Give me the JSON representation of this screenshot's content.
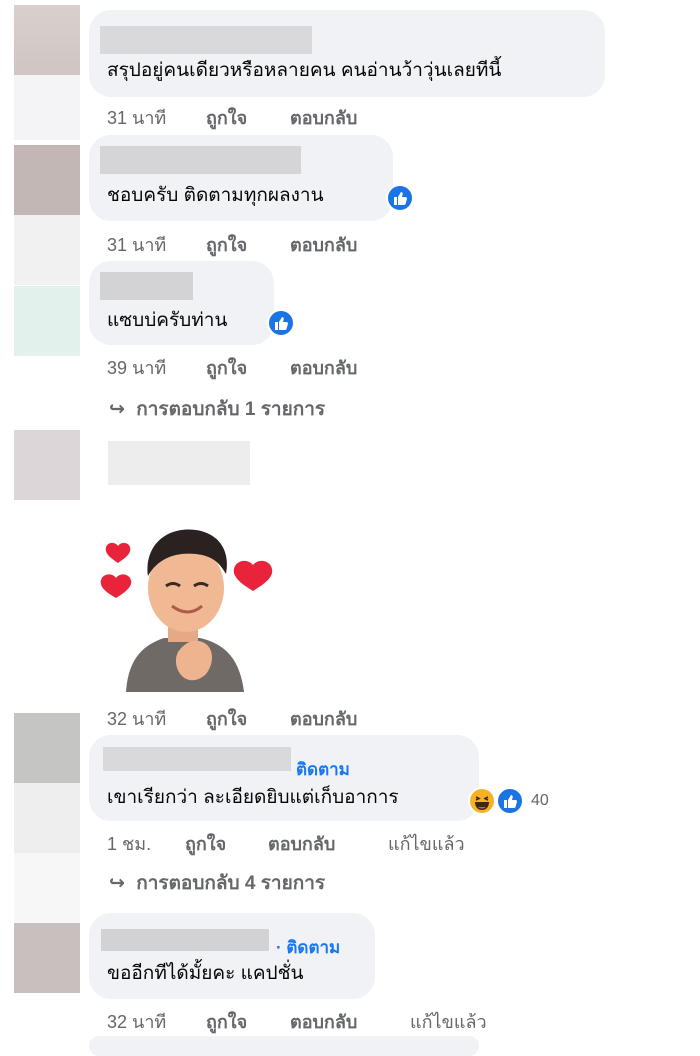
{
  "comments": [
    {
      "text": "สรุปอยู่คนเดียวหรือหลายคน คนอ่านว้าวุ่นเลยทีนี้",
      "time": "31 นาที",
      "like": "ถูกใจ",
      "reply": "ตอบกลับ"
    },
    {
      "text": "ชอบครับ ติดตามทุกผลงาน",
      "time": "31 นาที",
      "like": "ถูกใจ",
      "reply": "ตอบกลับ",
      "reaction": "like-icon"
    },
    {
      "text": "แซบบ่ครับท่าน",
      "time": "39 นาที",
      "like": "ถูกใจ",
      "reply": "ตอบกลับ",
      "reaction": "like-icon",
      "replies_link": "การตอบกลับ 1 รายการ"
    },
    {
      "sticker": "avatar-sticker-hearts",
      "time": "32 นาที",
      "like": "ถูกใจ",
      "reply": "ตอบกลับ"
    },
    {
      "follow": "ติดตาม",
      "text": "เขาเรียกว่า ละเอียดยิบแต่เก็บอาการ",
      "time": "1 ชม.",
      "like": "ถูกใจ",
      "reply": "ตอบกลับ",
      "edited": "แก้ไขแล้ว",
      "reactions": [
        "haha-icon",
        "like-icon"
      ],
      "reaction_count": "40",
      "replies_link": "การตอบกลับ 4 รายการ"
    },
    {
      "follow": "· ติดตาม",
      "text": "ขออีกทีได้มั้ยคะ แคปชั่น",
      "time": "32 นาที",
      "like": "ถูกใจ",
      "reply": "ตอบกลับ",
      "edited": "แก้ไขแล้ว"
    }
  ],
  "colors": {
    "bubble": "#f0f2f5",
    "meta_text": "#65676b",
    "link_blue": "#1877f2",
    "like_blue": "#1b74e4"
  }
}
